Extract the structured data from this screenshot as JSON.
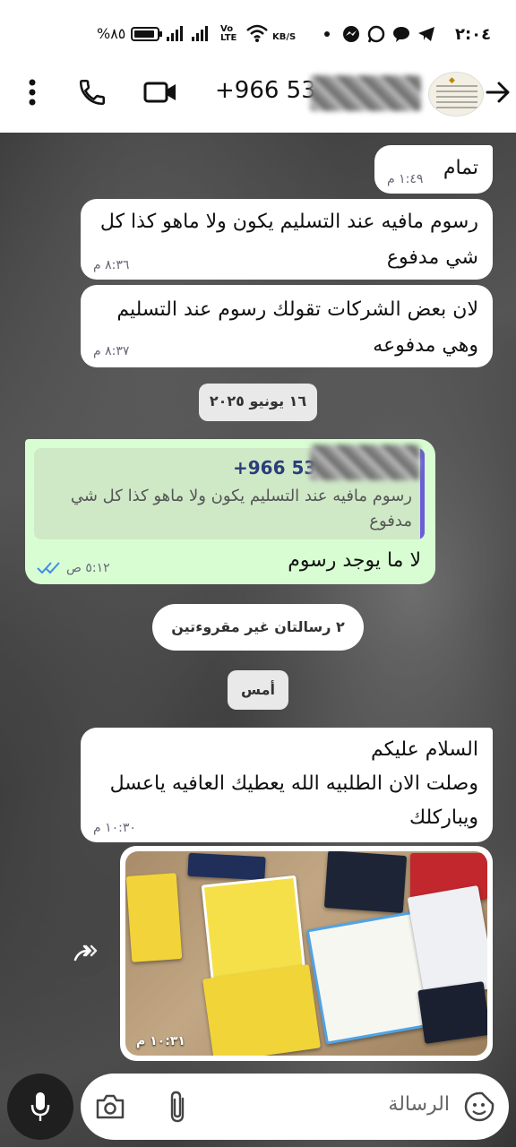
{
  "status_bar": {
    "time": "٢:٠٤",
    "battery": "%٨٥",
    "network_type": "Vo LTE",
    "speed_unit": "KB/S"
  },
  "header": {
    "contact_phone_prefix": "+966 53"
  },
  "messages": [
    {
      "text": "تمام",
      "time": "١:٤٩ م"
    },
    {
      "text": "رسوم مافيه عند التسليم يكون ولا ماهو كذا كل شي مدفوع",
      "time": "٨:٣٦ م"
    },
    {
      "text": "لان بعض الشركات تقولك رسوم عند التسليم وهي مدفوعه",
      "time": "٨:٣٧ م"
    }
  ],
  "date_separator_1": "١٦ يونيو ٢٠٢٥",
  "reply_message": {
    "quoted_sender": "+966 53",
    "quoted_text": "رسوم مافيه عند التسليم يكون ولا ماهو كذا كل شي مدفوع",
    "text": "لا ما يوجد رسوم",
    "time": "٥:١٢ ص"
  },
  "unread_banner": "٢ رسالتان غير مقروءتين",
  "date_separator_2": "أمس",
  "incoming_greeting": {
    "text": "السلام عليكم\nوصلت الان الطلبيه الله يعطيك العافيه ياعسل ويباركلك",
    "time": "١٠:٣٠ م"
  },
  "image_message": {
    "time": "١٠:٣١ م"
  },
  "input": {
    "placeholder": "الرسالة"
  },
  "colors": {
    "outgoing_bubble": "#d9fdd3",
    "incoming_bubble": "#ffffff",
    "read_ticks": "#3b8ee8",
    "quote_bar": "#6b5ed8"
  }
}
